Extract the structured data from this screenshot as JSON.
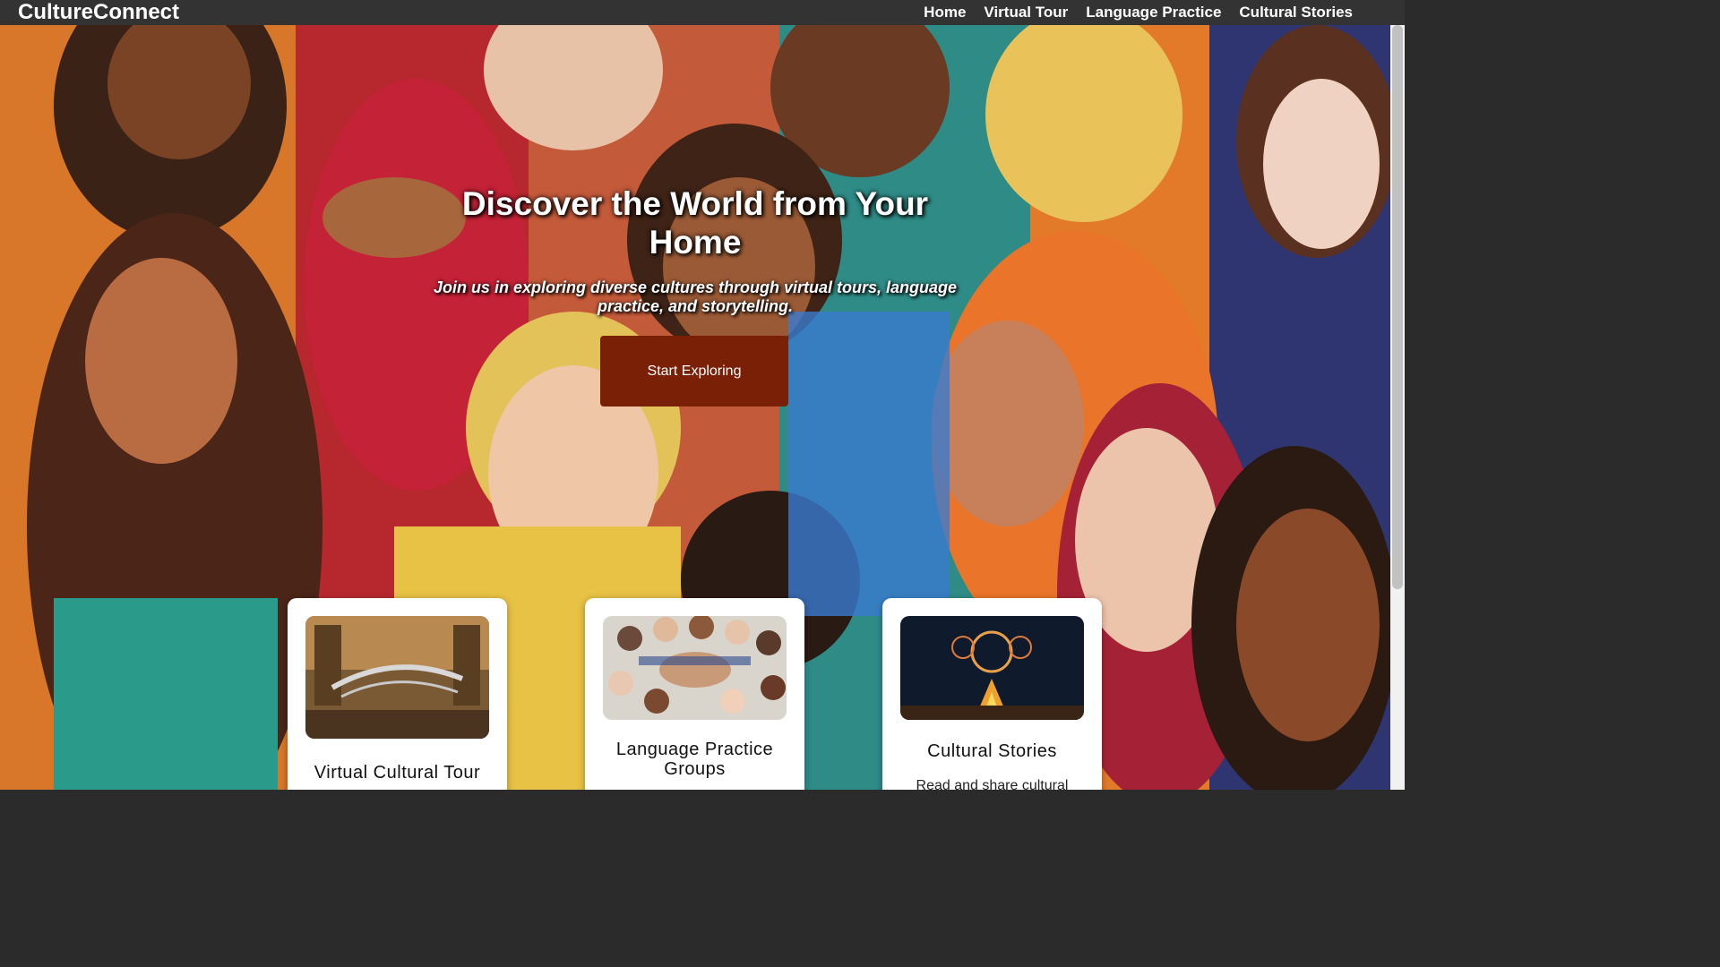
{
  "app": {
    "brand": "CultureConnect"
  },
  "nav": {
    "items": [
      "Home",
      "Virtual Tour",
      "Language Practice",
      "Cultural Stories"
    ]
  },
  "hero": {
    "title": "Discover the World from Your Home",
    "subtitle": "Join us in exploring diverse cultures through virtual tours, language practice, and storytelling.",
    "cta_label": "Start Exploring",
    "cta_color": "#7a2006"
  },
  "cards": [
    {
      "title": "Virtual Cultural Tour",
      "text": "",
      "image": "museum-whale-skeleton-photo"
    },
    {
      "title": "Language Practice Groups",
      "text": "",
      "image": "group-hands-together-photo"
    },
    {
      "title": "Cultural Stories",
      "text": "Read and share cultural",
      "image": "campfire-dreamcatchers-illustration"
    }
  ],
  "colors": {
    "topbar": "#333333",
    "scrollbar_track": "#f1f1f1",
    "scrollbar_thumb": "#c1c1c1"
  }
}
